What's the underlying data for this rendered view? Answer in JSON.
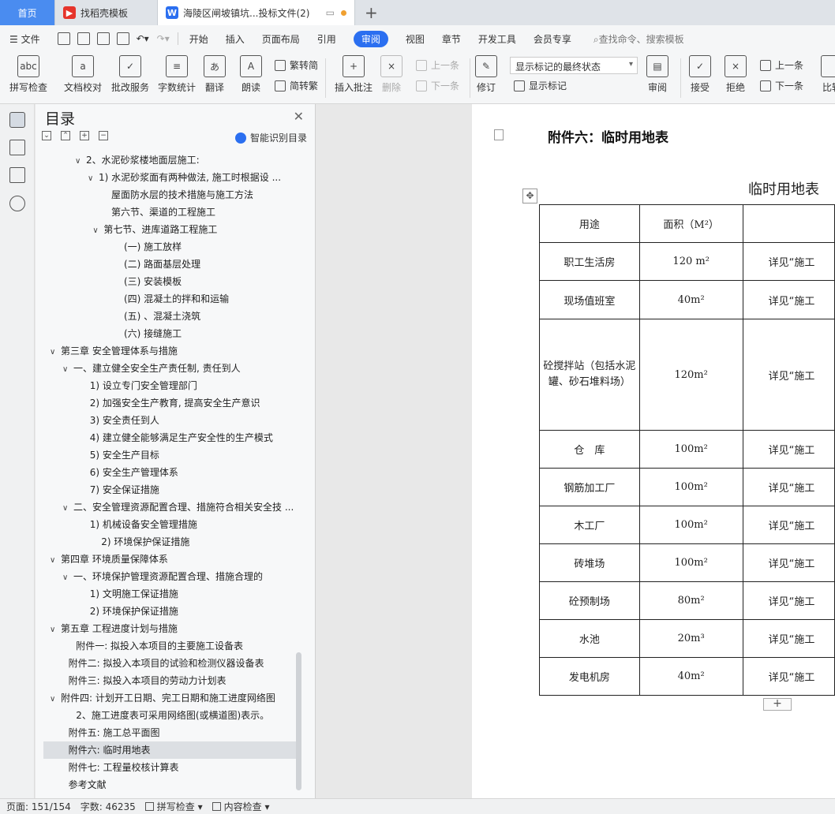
{
  "tabs": [
    {
      "label": "首页"
    },
    {
      "label": "找稻壳模板"
    },
    {
      "label": "海陵区闸坡镇坑...投标文件(2)"
    }
  ],
  "menu": {
    "file_label": "文件",
    "items": [
      "开始",
      "插入",
      "页面布局",
      "引用",
      "审阅",
      "视图",
      "章节",
      "开发工具",
      "会员专享"
    ],
    "active": "审阅",
    "search_placeholder": "查找命令、搜索模板"
  },
  "ribbon": {
    "spellcheck": "拼写检查",
    "doc_proof": "文档校对",
    "batch_service": "批改服务",
    "word_count": "字数统计",
    "translate": "翻译",
    "read_aloud": "朗读",
    "trad_to_simp": "繁转简",
    "simp_to_trad": "简转繁",
    "insert_comment": "插入批注",
    "delete": "删除",
    "prev": "上一条",
    "next": "下一条",
    "revise": "修订",
    "markup_state": "显示标记的最终状态",
    "show_markup": "显示标记",
    "review": "审阅",
    "accept": "接受",
    "reject": "拒绝",
    "prev2": "上一条",
    "next2": "下一条",
    "compare": "比较"
  },
  "nav": {
    "title": "目录",
    "smart_toc": "智能识别目录",
    "items": [
      {
        "text": "2、水泥砂浆楼地面层施工:",
        "level": 2,
        "chev": "∨"
      },
      {
        "text": "1) 水泥砂浆面有两种做法, 施工时根据设 ...",
        "level": 3,
        "chev": "∨"
      },
      {
        "text": "屋面防水层的技术措施与施工方法",
        "level": 4,
        "chev": ""
      },
      {
        "text": "第六节、渠道的工程施工",
        "level": 4,
        "chev": ""
      },
      {
        "text": "第七节、进库道路工程施工",
        "level": 3.4,
        "chev": "∨"
      },
      {
        "text": "(一) 施工放样",
        "level": 5,
        "chev": ""
      },
      {
        "text": "(二) 路面基层处理",
        "level": 5,
        "chev": ""
      },
      {
        "text": "(三) 安装模板",
        "level": 5,
        "chev": ""
      },
      {
        "text": "(四) 混凝土的拌和和运输",
        "level": 5,
        "chev": ""
      },
      {
        "text": "(五) 、混凝土浇筑",
        "level": 5,
        "chev": ""
      },
      {
        "text": "(六) 接缝施工",
        "level": 5,
        "chev": ""
      },
      {
        "text": "第三章 安全管理体系与措施",
        "level": 0,
        "chev": "∨"
      },
      {
        "text": "一、建立健全安全生产责任制, 责任到人",
        "level": 1,
        "chev": "∨"
      },
      {
        "text": "1) 设立专门安全管理部门",
        "level": 2.3,
        "chev": ""
      },
      {
        "text": "2) 加强安全生产教育, 提高安全生产意识",
        "level": 2.3,
        "chev": ""
      },
      {
        "text": "3) 安全责任到人",
        "level": 2.3,
        "chev": ""
      },
      {
        "text": "4) 建立健全能够满足生产安全性的生产模式",
        "level": 2.3,
        "chev": ""
      },
      {
        "text": "5) 安全生产目标",
        "level": 2.3,
        "chev": ""
      },
      {
        "text": "6) 安全生产管理体系",
        "level": 2.3,
        "chev": ""
      },
      {
        "text": "7) 安全保证措施",
        "level": 2.3,
        "chev": ""
      },
      {
        "text": "二、安全管理资源配置合理、措施符合相关安全技 ...",
        "level": 1,
        "chev": "∨"
      },
      {
        "text": "1) 机械设备安全管理措施",
        "level": 2.3,
        "chev": ""
      },
      {
        "text": "2) 环境保护保证措施",
        "level": 3.2,
        "chev": ""
      },
      {
        "text": "第四章 环境质量保障体系",
        "level": 0,
        "chev": "∨"
      },
      {
        "text": "一、环境保护管理资源配置合理、措施合理的",
        "level": 1,
        "chev": "∨"
      },
      {
        "text": "1) 文明施工保证措施",
        "level": 2.3,
        "chev": ""
      },
      {
        "text": "2) 环境保护保证措施",
        "level": 2.3,
        "chev": ""
      },
      {
        "text": "第五章 工程进度计划与措施",
        "level": 0,
        "chev": "∨"
      },
      {
        "text": "附件一: 拟投入本项目的主要施工设备表",
        "level": 1.2,
        "chev": ""
      },
      {
        "text": "附件二: 拟投入本项目的试验和检测仪器设备表",
        "level": 0.6,
        "chev": ""
      },
      {
        "text": "附件三: 拟投入本项目的劳动力计划表",
        "level": 0.6,
        "chev": ""
      },
      {
        "text": "附件四: 计划开工日期、完工日期和施工进度网络图",
        "level": 0,
        "chev": "∨"
      },
      {
        "text": "2、施工进度表可采用网络图(或横道图)表示。",
        "level": 1.2,
        "chev": ""
      },
      {
        "text": "附件五: 施工总平面图",
        "level": 0.6,
        "chev": ""
      },
      {
        "text": "附件六: 临时用地表",
        "level": 0.6,
        "chev": "",
        "selected": true
      },
      {
        "text": "附件七: 工程量校核计算表",
        "level": 0.6,
        "chev": ""
      },
      {
        "text": "参考文献",
        "level": 0.6,
        "chev": ""
      }
    ]
  },
  "document": {
    "attachment_title": "附件六：临时用地表",
    "table_title": "临时用地表",
    "headers": [
      "用途",
      "面积（M²）",
      ""
    ],
    "rows": [
      {
        "use": "职工生活房",
        "area": "120 m²",
        "note": "详见“施工"
      },
      {
        "use": "现场值班室",
        "area": "40m²",
        "note": "详见“施工"
      },
      {
        "use": "砼搅拌站（包括水泥罐、砂石堆料场）",
        "area": "120m²",
        "note": "详见“施工"
      },
      {
        "use": "仓　库",
        "area": "100m²",
        "note": "详见“施工"
      },
      {
        "use": "钢筋加工厂",
        "area": "100m²",
        "note": "详见“施工"
      },
      {
        "use": "木工厂",
        "area": "100m²",
        "note": "详见“施工"
      },
      {
        "use": "砖堆场",
        "area": "100m²",
        "note": "详见“施工"
      },
      {
        "use": "砼预制场",
        "area": "80m²",
        "note": "详见“施工"
      },
      {
        "use": "水池",
        "area": "20m³",
        "note": "详见“施工"
      },
      {
        "use": "发电机房",
        "area": "40m²",
        "note": "详见“施工"
      }
    ],
    "add_row": "+"
  },
  "status": {
    "page": "页面: 151/154",
    "words": "字数: 46235",
    "spellcheck": "拼写检查",
    "content_check": "内容检查"
  },
  "colors": {
    "accent": "#2b6ff0",
    "home_tab": "#4a8cf0"
  }
}
